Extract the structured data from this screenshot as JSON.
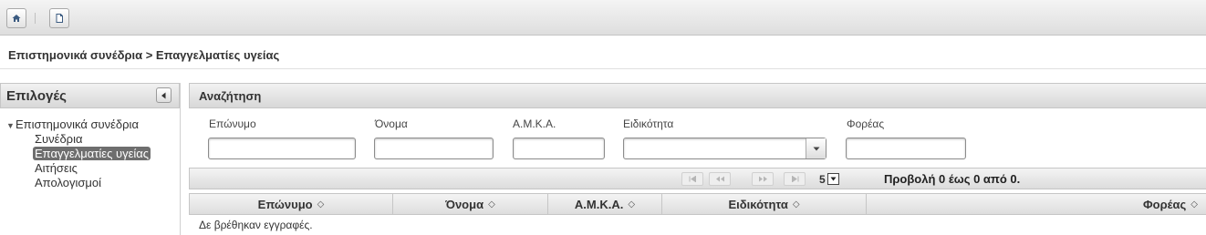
{
  "toolbar": {
    "buttons": [
      {
        "icon": "home-icon"
      },
      {
        "icon": "page-icon"
      }
    ]
  },
  "breadcrumb": "Επιστημονικά συνέδρια > Επαγγελματίες υγείας",
  "sidebar": {
    "title": "Επιλογές",
    "collapse_icon": "triangle-left-icon",
    "root": "Επιστημονικά συνέδρια",
    "items": [
      {
        "label": "Συνέδρια",
        "selected": false
      },
      {
        "label": "Επαγγελματίες υγείας",
        "selected": true
      },
      {
        "label": "Αιτήσεις",
        "selected": false
      },
      {
        "label": "Απολογισμοί",
        "selected": false
      }
    ]
  },
  "search": {
    "title": "Αναζήτηση",
    "fields": {
      "surname": {
        "label": "Επώνυμο",
        "value": ""
      },
      "name": {
        "label": "Όνομα",
        "value": ""
      },
      "amka": {
        "label": "Α.Μ.Κ.Α.",
        "value": ""
      },
      "specialty": {
        "label": "Ειδικότητα",
        "value": ""
      },
      "organization": {
        "label": "Φορέας",
        "value": ""
      }
    }
  },
  "pager": {
    "rows_per_page": "5",
    "info": "Προβολή 0 έως 0 από 0."
  },
  "table": {
    "columns": [
      "Επώνυμο",
      "Όνομα",
      "Α.Μ.Κ.Α.",
      "Ειδικότητα",
      "Φορέας"
    ],
    "sort_icon": "◇",
    "empty_message": "Δε βρέθηκαν εγγραφές."
  }
}
